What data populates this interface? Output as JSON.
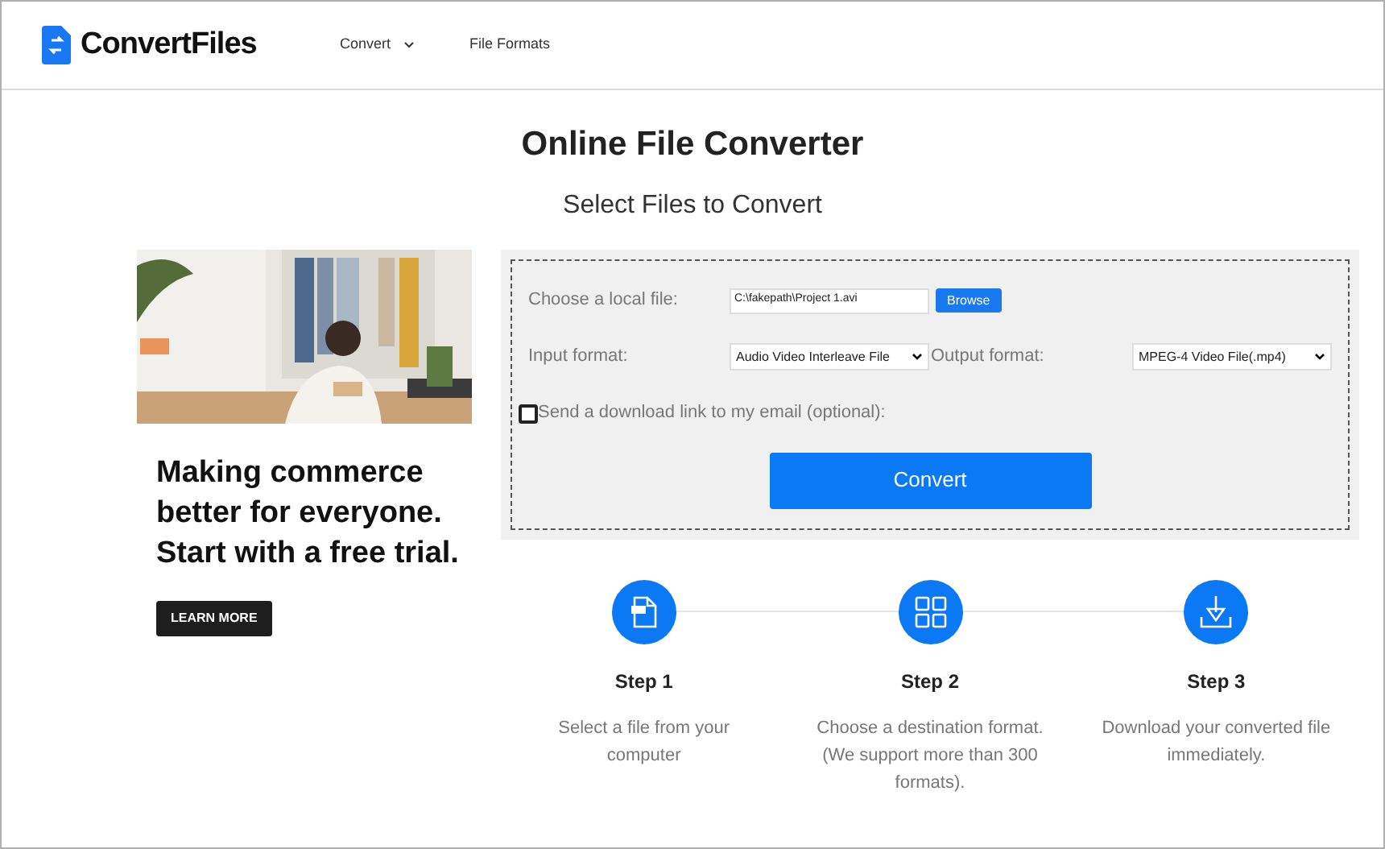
{
  "header": {
    "logo": "ConvertFiles",
    "nav": [
      {
        "label": "Convert",
        "kind": "dropdown"
      },
      {
        "label": "File Formats",
        "kind": "link"
      }
    ]
  },
  "title": "Online File Converter",
  "subtitle": "Select Files to Convert",
  "ad": {
    "headline": "Making commerce better for everyone. Start with a free trial.",
    "button": "LEARN MORE"
  },
  "form": {
    "file_label": "Choose a local file:",
    "file_value": "C:\\fakepath\\Project 1.avi",
    "browse": "Browse",
    "input_label": "Input format:",
    "input_value": "Audio Video Interleave File",
    "output_label": "Output format:",
    "output_value": "MPEG-4 Video File(.mp4)",
    "email_label": "Send a download link to my email (optional):",
    "email_checked": false,
    "convert": "Convert"
  },
  "steps": [
    {
      "kind": "file",
      "title": "Step 1",
      "text": "Select a file from your computer"
    },
    {
      "kind": "grid",
      "title": "Step 2",
      "text": "Choose a destination format. (We support more than 300 formats)."
    },
    {
      "kind": "download",
      "title": "Step 3",
      "text": "Download your converted file immediately."
    }
  ]
}
